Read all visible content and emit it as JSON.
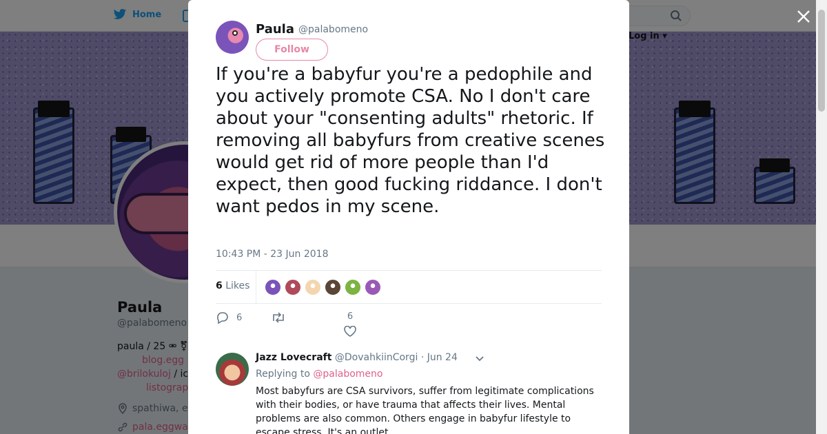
{
  "nav": {
    "home_label": "Home",
    "login_label": "Log in"
  },
  "profile": {
    "name": "Paula",
    "handle": "@palabomeno",
    "bio_line1": "paula / 25 ⚮ ⚧",
    "bio_link1": "blog.egg",
    "bio_mention": "@brilokuloj",
    "bio_mid": " / ic",
    "bio_link2": "listograp",
    "location": "spathiwa, e",
    "website": "pala.eggwa"
  },
  "tweet": {
    "author_name": "Paula",
    "author_handle": "@palabomeno",
    "follow_label": "Follow",
    "text": "If you're a babyfur you're a pedophile and you actively promote CSA. No I don't care about your \"consenting adults\" rhetoric. If removing all babyfurs from creative scenes would get rid of more people than I'd expect, then good fucking riddance. I don't want pedos in my scene.",
    "timestamp": "10:43 PM - 23 Jun 2018",
    "likes_count": "6",
    "likes_label": "Likes",
    "liker_colors": [
      "#7a54b8",
      "#b04a5a",
      "#f3d6b0",
      "#5a4636",
      "#7cb342",
      "#9b59b6"
    ],
    "reply_count": "6",
    "like_action_count": "6"
  },
  "reply": {
    "name": "Jazz Lovecraft",
    "handle": "@DovahkiinCorgi",
    "date": "· Jun 24",
    "replying_prefix": "Replying to",
    "replying_to": "@palabomeno",
    "text": "Most babyfurs are CSA survivors, suffer from legitimate complications with their bodies, or have trauma that affects their lives. Mental problems are also common. Others engage in babyfur lifestyle to escape stress. It's an outlet."
  }
}
